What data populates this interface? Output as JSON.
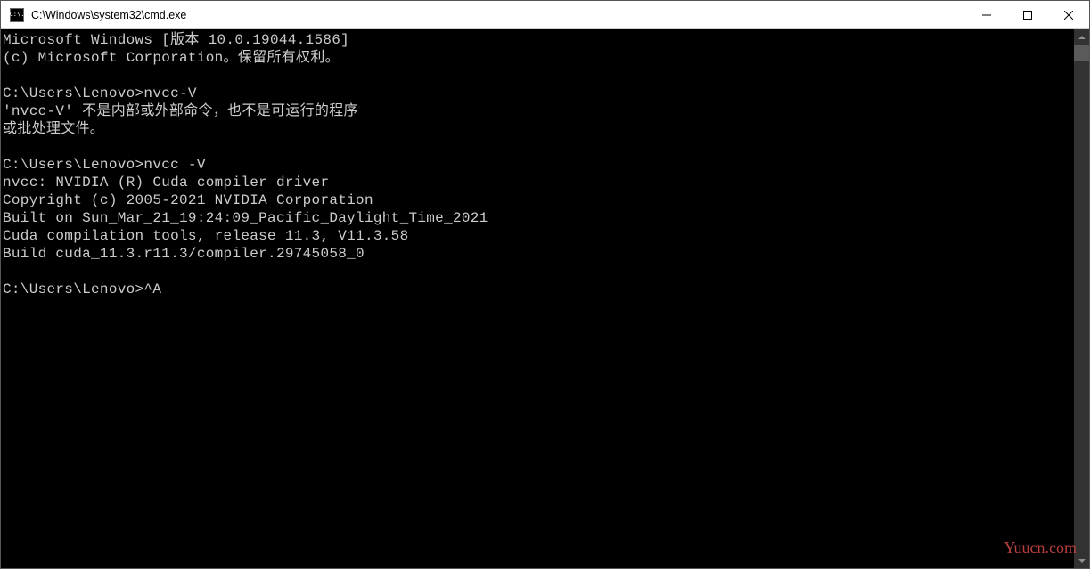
{
  "window": {
    "title": "C:\\Windows\\system32\\cmd.exe",
    "icon_label": "C:\\."
  },
  "console": {
    "lines": [
      "Microsoft Windows [版本 10.0.19044.1586]",
      "(c) Microsoft Corporation。保留所有权利。",
      "",
      "C:\\Users\\Lenovo>nvcc-V",
      "'nvcc-V' 不是内部或外部命令，也不是可运行的程序",
      "或批处理文件。",
      "",
      "C:\\Users\\Lenovo>nvcc -V",
      "nvcc: NVIDIA (R) Cuda compiler driver",
      "Copyright (c) 2005-2021 NVIDIA Corporation",
      "Built on Sun_Mar_21_19:24:09_Pacific_Daylight_Time_2021",
      "Cuda compilation tools, release 11.3, V11.3.58",
      "Build cuda_11.3.r11.3/compiler.29745058_0",
      "",
      "C:\\Users\\Lenovo>^A"
    ]
  },
  "watermark": "Yuucn.com"
}
